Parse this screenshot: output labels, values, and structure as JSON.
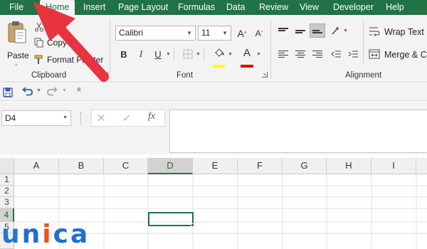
{
  "tabs": [
    {
      "key": "file",
      "label": "File"
    },
    {
      "key": "home",
      "label": "Home",
      "active": true
    },
    {
      "key": "insert",
      "label": "Insert"
    },
    {
      "key": "page_layout",
      "label": "Page Layout"
    },
    {
      "key": "formulas",
      "label": "Formulas"
    },
    {
      "key": "data",
      "label": "Data"
    },
    {
      "key": "review",
      "label": "Review"
    },
    {
      "key": "view",
      "label": "View"
    },
    {
      "key": "developer",
      "label": "Developer"
    },
    {
      "key": "help",
      "label": "Help"
    }
  ],
  "ribbon": {
    "clipboard": {
      "paste_label": "Paste",
      "cut_label": "Cut",
      "copy_label": "Copy",
      "format_painter_label": "Format Painter",
      "group_label": "Clipboard"
    },
    "font": {
      "font_name": "Calibri",
      "font_size": "11",
      "group_label": "Font",
      "bold_glyph": "B",
      "italic_glyph": "I",
      "underline_glyph": "U",
      "grow_glyph": "A",
      "shrink_glyph": "A",
      "font_color_glyph": "A",
      "highlight_color": "#ffff00",
      "font_color": "#e00000"
    },
    "alignment": {
      "wrap_text_label": "Wrap Text",
      "merge_label": "Merge & Ce",
      "group_label": "Alignment"
    }
  },
  "formula_bar": {
    "name_box": "D4",
    "cancel_glyph": "✕",
    "enter_glyph": "✓",
    "fx_glyph": "fx",
    "formula_value": ""
  },
  "sheet": {
    "columns": [
      "A",
      "B",
      "C",
      "D",
      "E",
      "F",
      "G",
      "H",
      "I"
    ],
    "rows": [
      "1",
      "2",
      "3",
      "4",
      "5",
      "6"
    ],
    "selected_column": "D",
    "selected_row": "4"
  },
  "watermark": {
    "text": "unica",
    "letters": [
      "u",
      "n",
      "i",
      "c",
      "a"
    ]
  },
  "colors": {
    "excel_green": "#217346",
    "ribbon_bg": "#f3f3f3",
    "annotation_arrow": "#e8343f",
    "watermark_blue": "#1f6fd0",
    "watermark_orange": "#e8531f"
  },
  "icons": {
    "paste": "clipboard-paste-icon",
    "cut": "scissors-icon",
    "copy": "copy-icon",
    "format_painter": "paintbrush-icon",
    "save": "save-icon",
    "undo": "undo-icon",
    "redo": "redo-icon",
    "borders": "borders-icon",
    "fill_color": "paint-bucket-icon",
    "orientation": "text-orientation-icon",
    "wrap": "wrap-text-icon",
    "merge": "merge-center-icon"
  }
}
